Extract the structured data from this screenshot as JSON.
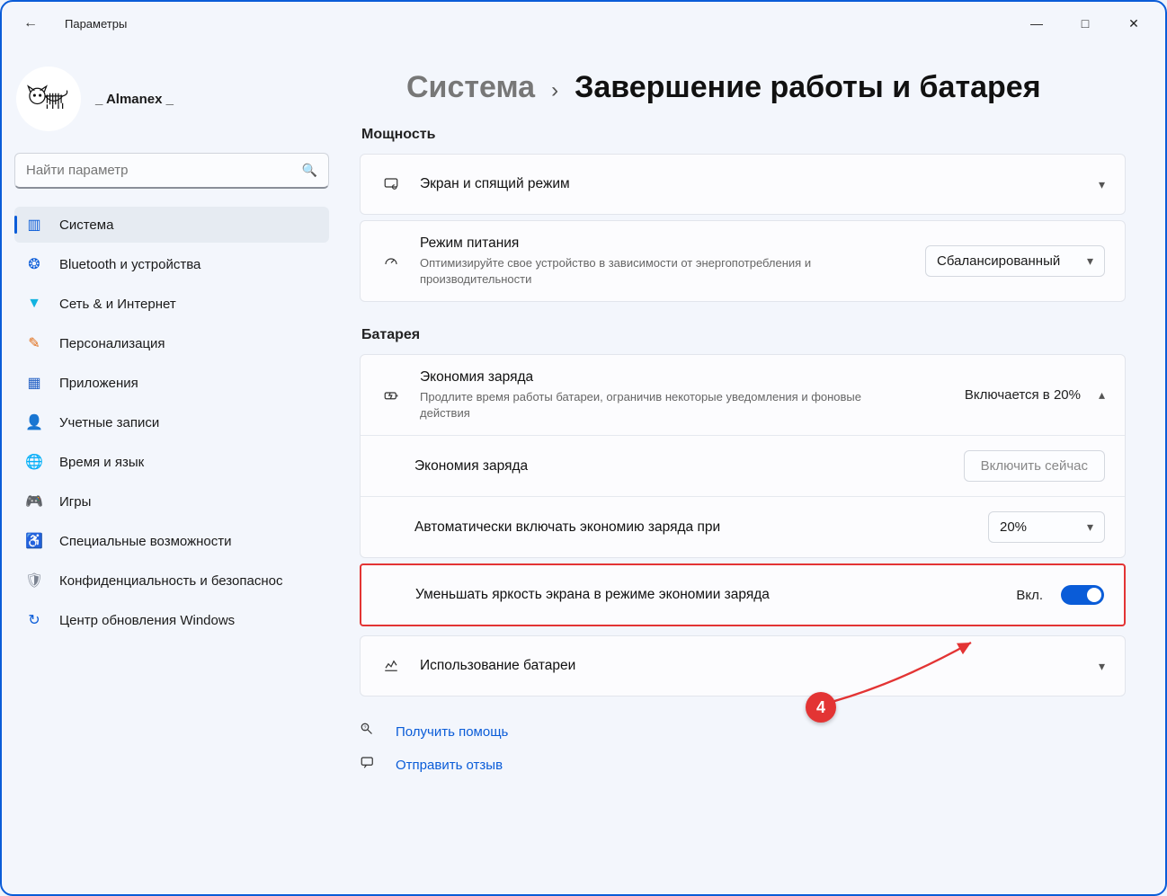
{
  "window": {
    "title": "Параметры",
    "user_name": "_ Almanex _"
  },
  "search": {
    "placeholder": "Найти параметр"
  },
  "sidebar": {
    "items": [
      {
        "label": "Система"
      },
      {
        "label": "Bluetooth и устройства"
      },
      {
        "label": "Сеть & и Интернет"
      },
      {
        "label": "Персонализация"
      },
      {
        "label": "Приложения"
      },
      {
        "label": "Учетные записи"
      },
      {
        "label": "Время и язык"
      },
      {
        "label": "Игры"
      },
      {
        "label": "Специальные возможности"
      },
      {
        "label": "Конфиденциальность и безопаснос"
      },
      {
        "label": "Центр обновления Windows"
      }
    ]
  },
  "breadcrumb": {
    "seg1": "Система",
    "seg2": "Завершение работы и батарея"
  },
  "sections": {
    "power_label": "Мощность",
    "battery_label": "Батарея",
    "screen_sleep": {
      "title": "Экран и спящий режим"
    },
    "power_mode": {
      "title": "Режим питания",
      "desc": "Оптимизируйте свое устройство в зависимости от энергопотребления и производительности",
      "value": "Сбалансированный"
    },
    "battery_saver": {
      "title": "Экономия заряда",
      "desc": "Продлите время работы батареи, ограничив некоторые уведомления и фоновые действия",
      "trail": "Включается в 20%"
    },
    "saver_now": {
      "title": "Экономия заряда",
      "button": "Включить сейчас"
    },
    "saver_auto": {
      "title": "Автоматически включать экономию заряда при",
      "value": "20%"
    },
    "dim": {
      "title": "Уменьшать яркость экрана в режиме экономии заряда",
      "state": "Вкл."
    },
    "usage": {
      "title": "Использование батареи"
    }
  },
  "footer": {
    "help": "Получить помощь",
    "feedback": "Отправить отзыв"
  },
  "callout": "4"
}
